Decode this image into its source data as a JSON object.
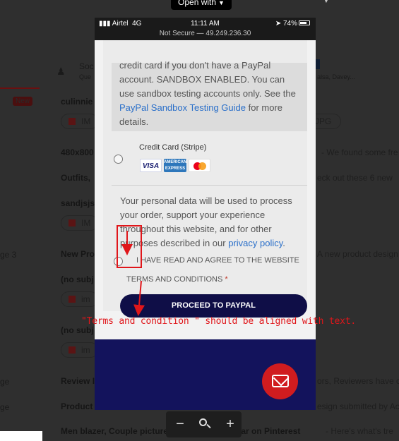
{
  "viewer": {
    "open_with_label": "Open with",
    "zoom": {
      "minus": "−",
      "plus": "+"
    }
  },
  "background": {
    "sidebar": {
      "badge": "New",
      "labels": [
        "ge 3",
        "ge",
        "ge"
      ]
    },
    "header": {
      "title": "Soc",
      "sub": "Que",
      "right_sub": "alsa, Davey..."
    },
    "rows": [
      {
        "sender": "culinnie",
        "subject": "",
        "snippet": ""
      },
      {
        "sender": "480x800",
        "subject": "",
        "snippet": "- We found some fre"
      },
      {
        "sender": "Outfits,",
        "subject": "",
        "snippet": "eck out these 6 new"
      },
      {
        "sender": "sandjsjs",
        "subject": "",
        "snippet": ""
      },
      {
        "sender": "New Pro",
        "subject": "",
        "snippet": "A new product design"
      },
      {
        "sender": "(no subj",
        "subject": "",
        "snippet": ""
      },
      {
        "sender": "(no subj",
        "subject": "",
        "snippet": ""
      },
      {
        "sender": "Review I",
        "subject": "",
        "snippet": "ors, Reviewers have c"
      },
      {
        "sender": "Product",
        "subject": "",
        "snippet": "esign submitted by Ac"
      },
      {
        "sender": "Men blazer, Couple pictures, and more popular on Pinterest",
        "subject": "",
        "snippet": "- Here's what's tre"
      }
    ],
    "chips": [
      "IM",
      "JPG",
      "IM",
      "im",
      "im"
    ]
  },
  "phone": {
    "status": {
      "carrier": "Airtel",
      "network": "4G",
      "time": "11:11 AM",
      "battery": "74%",
      "url": "Not Secure — 49.249.236.30"
    },
    "paypal_info": {
      "line1": "credit card if you don't have a PayPal",
      "line2": "account. SANDBOX ENABLED. You can",
      "line3": "use sandbox testing accounts only. See the",
      "link": "PayPal Sandbox Testing Guide",
      "after_link": " for more",
      "line5": "details."
    },
    "credit_card_label": "Credit Card (Stripe)",
    "card_logos": {
      "visa": "VISA",
      "amex": "AMERICAN EXPRESS"
    },
    "privacy": {
      "text": "Your personal data will be used to process your order, support your experience throughout this website, and for other purposes described in our ",
      "link": "privacy policy",
      "end": "."
    },
    "terms": {
      "line1": "I HAVE READ AND AGREE TO THE WEBSITE",
      "line2": "TERMS AND CONDITIONS",
      "required": "*"
    },
    "proceed_label": "PROCEED TO PAYPAL"
  },
  "annotation": {
    "note": "\"Terms and condition \" should be aligned with text.",
    "color": "#e0161a"
  }
}
